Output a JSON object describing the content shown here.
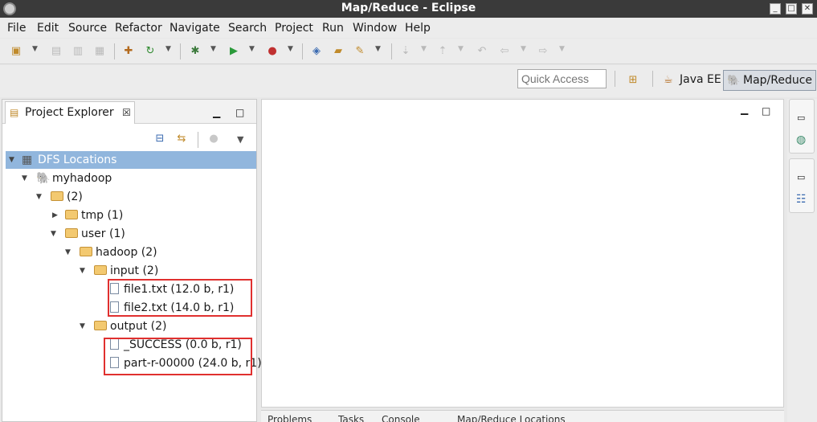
{
  "window": {
    "title": "Map/Reduce - Eclipse"
  },
  "menu": [
    "File",
    "Edit",
    "Source",
    "Refactor",
    "Navigate",
    "Search",
    "Project",
    "Run",
    "Window",
    "Help"
  ],
  "quick_access": {
    "placeholder": "Quick Access"
  },
  "perspectives": [
    {
      "label": "Java EE",
      "icon": "java-ee-icon"
    },
    {
      "label": "Map/Reduce",
      "icon": "elephant-icon"
    }
  ],
  "project_explorer": {
    "tab_label": "Project Explorer",
    "tree": [
      {
        "label": "DFS Locations",
        "icon": "dfs-icon"
      },
      {
        "label": "myhadoop",
        "icon": "elephant-icon"
      },
      {
        "label": "(2)",
        "icon": "folder-icon"
      },
      {
        "label": "tmp (1)",
        "icon": "folder-icon"
      },
      {
        "label": "user (1)",
        "icon": "folder-icon"
      },
      {
        "label": "hadoop (2)",
        "icon": "folder-icon"
      },
      {
        "label": "input (2)",
        "icon": "folder-icon"
      },
      {
        "label": "file1.txt (12.0 b, r1)",
        "icon": "file-icon"
      },
      {
        "label": "file2.txt (14.0 b, r1)",
        "icon": "file-icon"
      },
      {
        "label": "output (2)",
        "icon": "folder-icon"
      },
      {
        "label": "_SUCCESS (0.0 b, r1)",
        "icon": "file-icon"
      },
      {
        "label": "part-r-00000 (24.0 b, r1)",
        "icon": "file-icon"
      }
    ]
  },
  "bottom_tabs": [
    "Problems",
    "Tasks",
    "Console",
    "Map/Reduce Locations"
  ]
}
